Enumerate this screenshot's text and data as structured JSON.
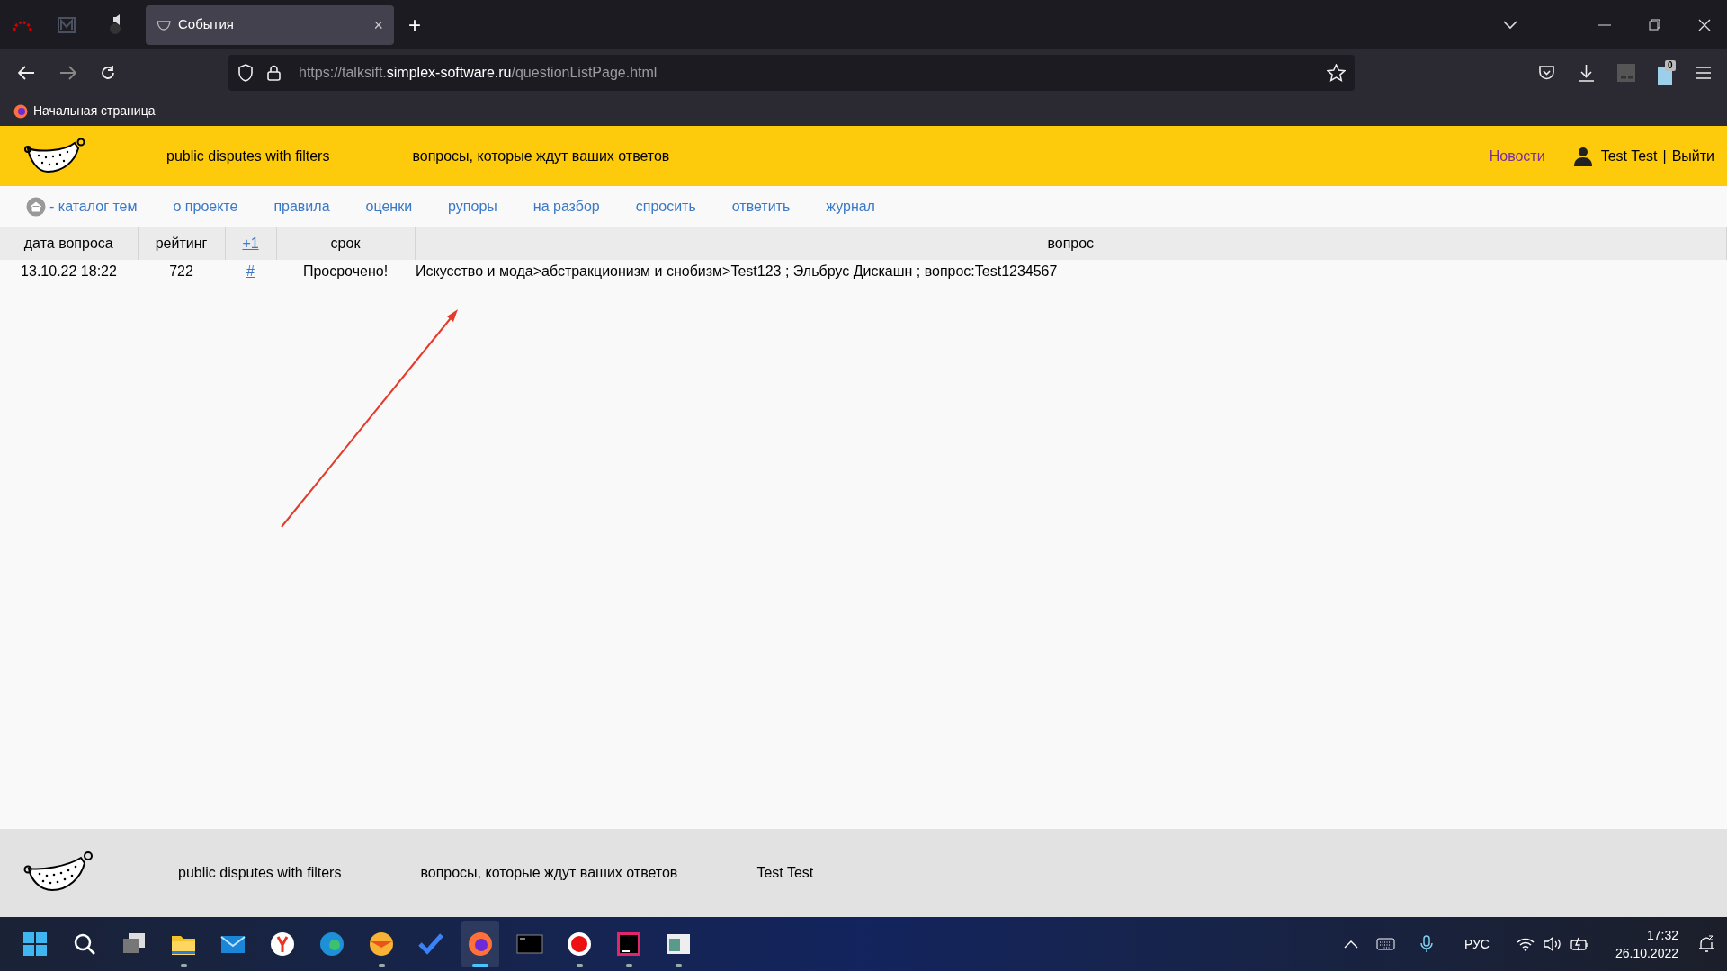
{
  "browser": {
    "tab": {
      "title": "События",
      "selected": true,
      "close": "×"
    },
    "new_tab": "+",
    "url": {
      "prefix": "https://talksift.",
      "domain": "simplex-software.ru",
      "path": "/questionListPage.html"
    },
    "extension_badge": "0",
    "bookmarks": [
      {
        "label": "Начальная страница"
      }
    ]
  },
  "header": {
    "links": [
      "public disputes with filters",
      "вопросы, которые ждут ваших ответов"
    ],
    "news": "Новости",
    "user": "Test Test",
    "separator": "|",
    "logout": "Выйти"
  },
  "nav": [
    {
      "label": "- каталог тем",
      "kind": "home"
    },
    {
      "label": "о проекте",
      "kind": "link"
    },
    {
      "label": "правила",
      "kind": "link"
    },
    {
      "label": "оценки",
      "kind": "link"
    },
    {
      "label": "рупоры",
      "kind": "link"
    },
    {
      "label": "на разбор",
      "kind": "link"
    },
    {
      "label": "спросить",
      "kind": "link"
    },
    {
      "label": "ответить",
      "kind": "link"
    },
    {
      "label": "журнал",
      "kind": "link"
    }
  ],
  "table": {
    "columns": [
      {
        "label": "дата вопроса",
        "link": false
      },
      {
        "label": "рейтинг",
        "link": false
      },
      {
        "label": "+1",
        "link": true
      },
      {
        "label": "срок",
        "link": false
      },
      {
        "label": "вопрос",
        "link": false
      }
    ],
    "rows": [
      [
        "13.10.22 18:22",
        "722",
        "#",
        "Просрочено!",
        "Искусство и мода>абстракционизм и снобизм>Test123 ; Эльбрус Дискашн ; вопрос:Test1234567"
      ]
    ]
  },
  "footer": {
    "texts": [
      "public disputes with filters",
      "вопросы, которые ждут ваших ответов",
      "Test Test"
    ]
  },
  "taskbar": {
    "apps": [
      {
        "kind": "start",
        "running": false,
        "active": false
      },
      {
        "kind": "search",
        "running": false,
        "active": false
      },
      {
        "kind": "taskview",
        "running": false,
        "active": false
      },
      {
        "kind": "folder",
        "running": true,
        "active": false
      },
      {
        "kind": "mail",
        "running": false,
        "active": false
      },
      {
        "kind": "yandex",
        "running": false,
        "active": false
      },
      {
        "kind": "edge",
        "running": false,
        "active": false
      },
      {
        "kind": "orange",
        "running": true,
        "active": false
      },
      {
        "kind": "todo",
        "running": false,
        "active": false
      },
      {
        "kind": "firefox",
        "running": true,
        "active": true
      },
      {
        "kind": "terminal",
        "running": false,
        "active": false
      },
      {
        "kind": "record",
        "running": true,
        "active": false
      },
      {
        "kind": "ide",
        "running": true,
        "active": false
      },
      {
        "kind": "window",
        "running": true,
        "active": false
      }
    ],
    "language": "РУС",
    "time": "17:32",
    "date": "26.10.2022"
  }
}
